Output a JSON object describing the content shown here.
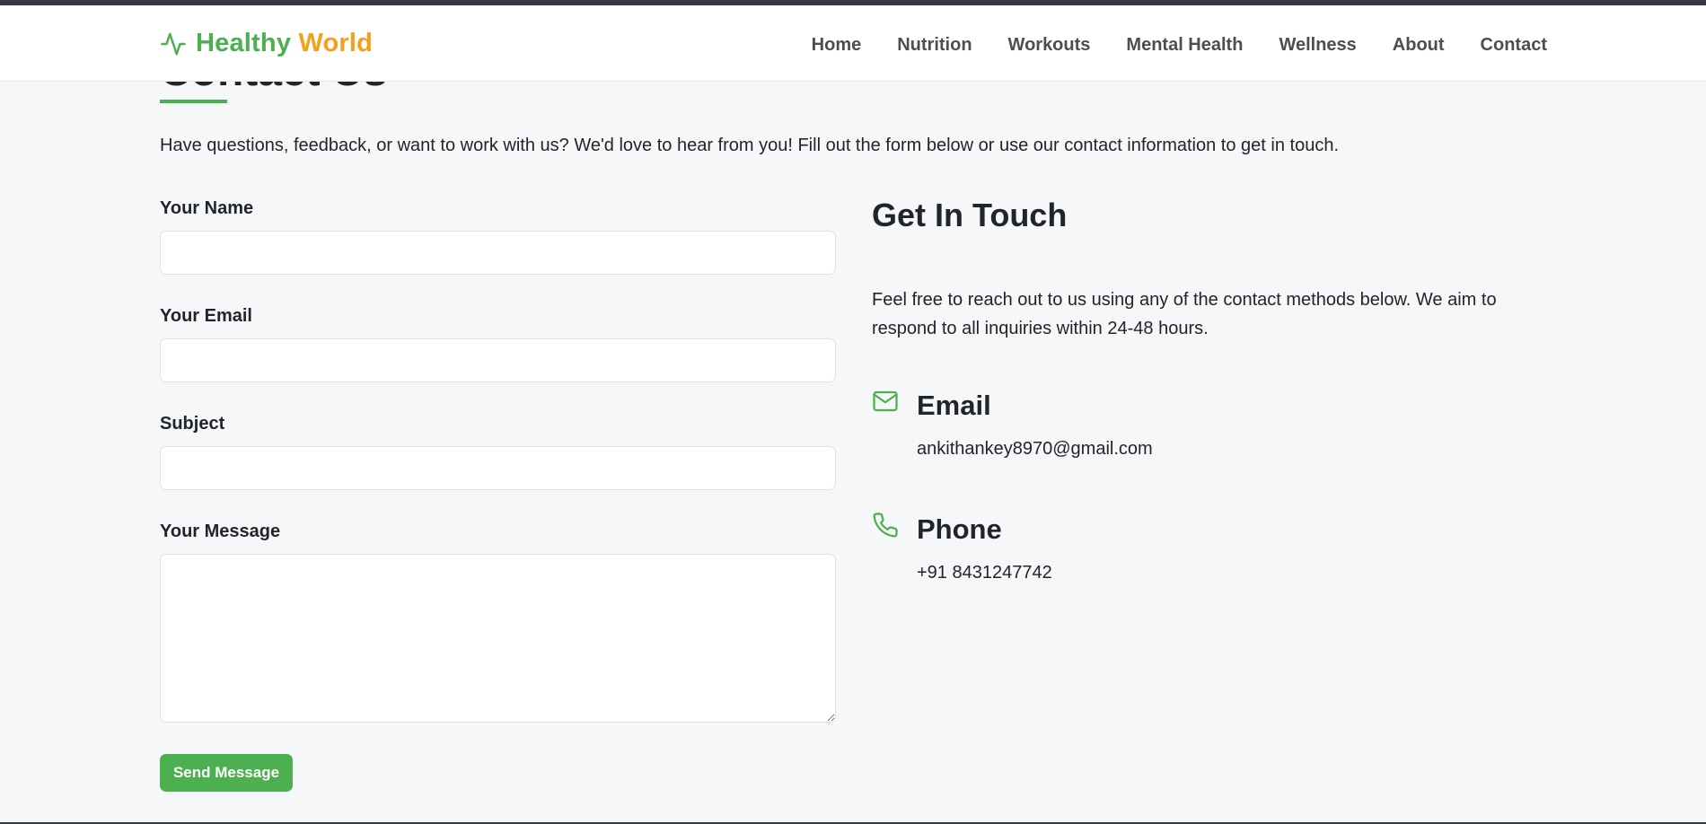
{
  "brand": {
    "word1": "Healthy",
    "word2": "World",
    "icon": "pulse-icon"
  },
  "nav": {
    "items": [
      {
        "label": "Home"
      },
      {
        "label": "Nutrition"
      },
      {
        "label": "Workouts"
      },
      {
        "label": "Mental Health"
      },
      {
        "label": "Wellness"
      },
      {
        "label": "About"
      },
      {
        "label": "Contact"
      }
    ]
  },
  "page": {
    "title": "Contact Us",
    "intro": "Have questions, feedback, or want to work with us? We'd love to hear from you! Fill out the form below or use our contact information to get in touch."
  },
  "form": {
    "name_label": "Your Name",
    "name_value": "",
    "email_label": "Your Email",
    "email_value": "",
    "subject_label": "Subject",
    "subject_value": "",
    "message_label": "Your Message",
    "message_value": "",
    "submit_label": "Send Message"
  },
  "contact": {
    "title": "Get In Touch",
    "description": "Feel free to reach out to us using any of the contact methods below. We aim to respond to all inquiries within 24-48 hours.",
    "email": {
      "title": "Email",
      "value": "ankithankey8970@gmail.com",
      "icon": "envelope-icon"
    },
    "phone": {
      "title": "Phone",
      "value": "+91 8431247742",
      "icon": "phone-icon"
    }
  },
  "colors": {
    "accent": "#4caf50",
    "brand_secondary": "#f5a01a",
    "background": "#f6f7f9",
    "text": "#212529"
  }
}
